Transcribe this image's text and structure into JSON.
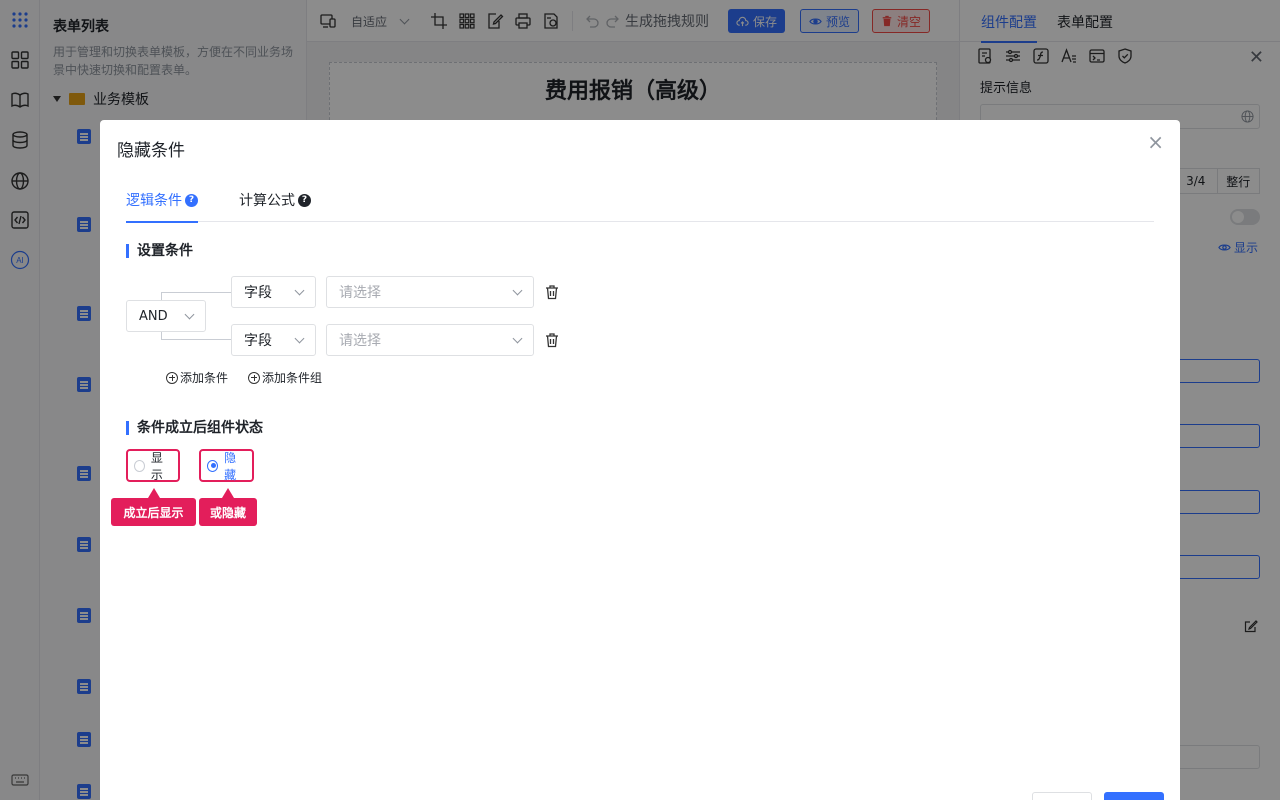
{
  "colors": {
    "accent": "#3370ff",
    "danger": "#f54a45",
    "callout": "#e31e5b"
  },
  "rail": {
    "icons": [
      "apps-grid-icon",
      "dashboard-icon",
      "book-icon",
      "database-icon",
      "globe-icon",
      "code-icon",
      "ai-icon",
      "keyboard-icon"
    ],
    "ai_label": "AI"
  },
  "form_list": {
    "title": "表单列表",
    "description": "用于管理和切换表单模板，方便在不同业务场景中快速切换和配置表单。",
    "folder": "业务模板"
  },
  "toolbar": {
    "layout_select": "自适应",
    "generate_rules": "生成拖拽规则",
    "save": "保存",
    "preview": "预览",
    "clear": "清空"
  },
  "canvas": {
    "form_title": "费用报销（高级）"
  },
  "right_panel": {
    "tabs": [
      "组件配置",
      "表单配置"
    ],
    "tip_label": "提示信息",
    "width_options": [
      "3/4",
      "整行"
    ],
    "show_label": "显示"
  },
  "modal": {
    "title": "隐藏条件",
    "close": "×",
    "tabs": [
      {
        "label": "逻辑条件",
        "help": "?"
      },
      {
        "label": "计算公式",
        "help": "?"
      }
    ],
    "set_conditions_heading": "设置条件",
    "logic_operator": "AND",
    "conditions": [
      {
        "field_label": "字段",
        "value_placeholder": "请选择"
      },
      {
        "field_label": "字段",
        "value_placeholder": "请选择"
      }
    ],
    "add_condition": "添加条件",
    "add_condition_group": "添加条件组",
    "state_heading": "条件成立后组件状态",
    "state_options": [
      {
        "label": "显示",
        "checked": false
      },
      {
        "label": "隐藏",
        "checked": true
      }
    ],
    "callouts": [
      "成立后显示",
      "或隐藏"
    ]
  }
}
